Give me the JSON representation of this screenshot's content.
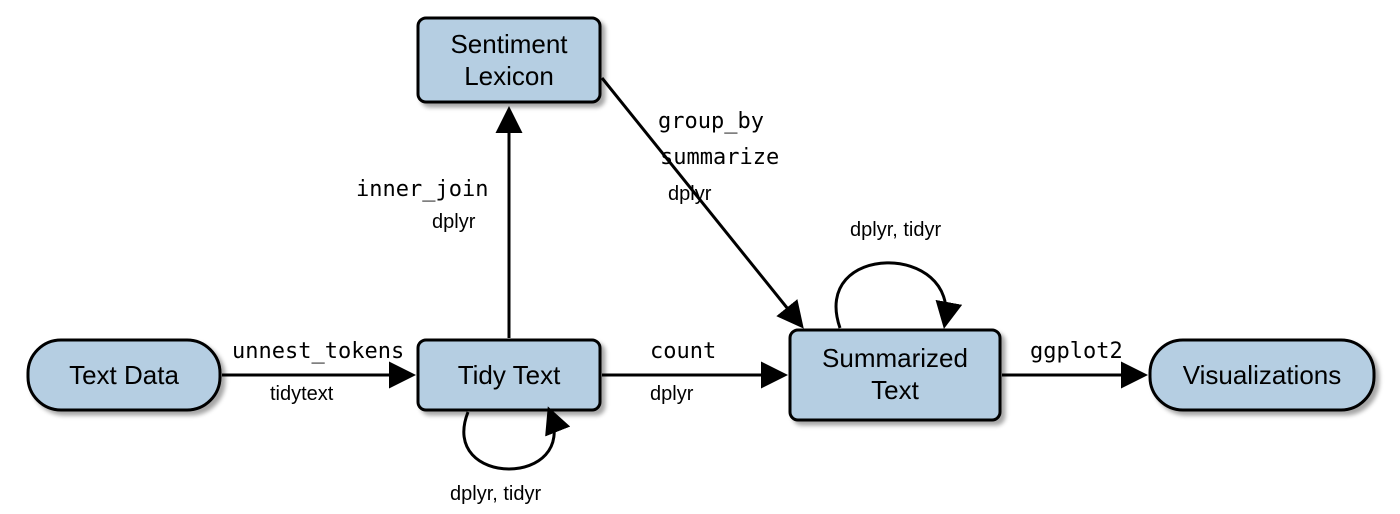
{
  "nodes": {
    "text_data": {
      "label": "Text Data"
    },
    "tidy_text": {
      "label": "Tidy Text"
    },
    "sentiment_lexicon_line1": "Sentiment",
    "sentiment_lexicon_line2": "Lexicon",
    "summarized_text_line1": "Summarized",
    "summarized_text_line2": "Text",
    "visualizations": {
      "label": "Visualizations"
    }
  },
  "edges": {
    "e1_main": "unnest_tokens",
    "e1_sub": "tidytext",
    "e2_main": "inner_join",
    "e2_sub": "dplyr",
    "e3_main1": "group_by",
    "e3_main2": "summarize",
    "e3_sub": "dplyr",
    "e4_main": "count",
    "e4_sub": "dplyr",
    "e5_main": "ggplot2",
    "loop_tidy": "dplyr, tidyr",
    "loop_sum": "dplyr, tidyr"
  },
  "colors": {
    "node_fill": "#b5cee2",
    "node_stroke": "#000000"
  }
}
